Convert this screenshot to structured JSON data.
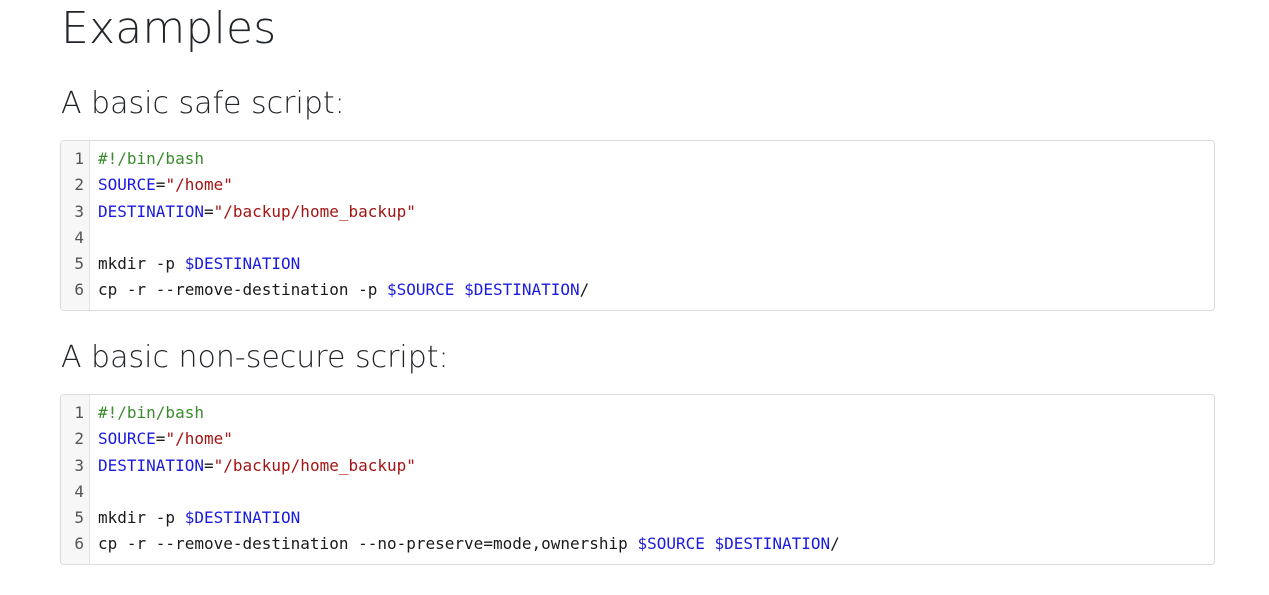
{
  "title": "Examples",
  "sections": [
    {
      "heading": "A basic safe script:",
      "lines": [
        {
          "n": "1",
          "parts": [
            {
              "t": "#!/bin/bash",
              "c": "cm"
            }
          ]
        },
        {
          "n": "2",
          "parts": [
            {
              "t": "SOURCE",
              "c": "var"
            },
            {
              "t": "=",
              "c": "plain"
            },
            {
              "t": "\"/home\"",
              "c": "str"
            }
          ]
        },
        {
          "n": "3",
          "parts": [
            {
              "t": "DESTINATION",
              "c": "var"
            },
            {
              "t": "=",
              "c": "plain"
            },
            {
              "t": "\"/backup/home_backup\"",
              "c": "str"
            }
          ]
        },
        {
          "n": "4",
          "parts": []
        },
        {
          "n": "5",
          "parts": [
            {
              "t": "mkdir -p ",
              "c": "plain"
            },
            {
              "t": "$DESTINATION",
              "c": "var"
            }
          ]
        },
        {
          "n": "6",
          "parts": [
            {
              "t": "cp -r --remove-destination -p ",
              "c": "plain"
            },
            {
              "t": "$SOURCE",
              "c": "var"
            },
            {
              "t": " ",
              "c": "plain"
            },
            {
              "t": "$DESTINATION",
              "c": "var"
            },
            {
              "t": "/",
              "c": "plain"
            }
          ]
        }
      ]
    },
    {
      "heading": "A basic non-secure script:",
      "lines": [
        {
          "n": "1",
          "parts": [
            {
              "t": "#!/bin/bash",
              "c": "cm"
            }
          ]
        },
        {
          "n": "2",
          "parts": [
            {
              "t": "SOURCE",
              "c": "var"
            },
            {
              "t": "=",
              "c": "plain"
            },
            {
              "t": "\"/home\"",
              "c": "str"
            }
          ]
        },
        {
          "n": "3",
          "parts": [
            {
              "t": "DESTINATION",
              "c": "var"
            },
            {
              "t": "=",
              "c": "plain"
            },
            {
              "t": "\"/backup/home_backup\"",
              "c": "str"
            }
          ]
        },
        {
          "n": "4",
          "parts": []
        },
        {
          "n": "5",
          "parts": [
            {
              "t": "mkdir -p ",
              "c": "plain"
            },
            {
              "t": "$DESTINATION",
              "c": "var"
            }
          ]
        },
        {
          "n": "6",
          "parts": [
            {
              "t": "cp -r --remove-destination --no-preserve=mode,ownership ",
              "c": "plain"
            },
            {
              "t": "$SOURCE",
              "c": "var"
            },
            {
              "t": " ",
              "c": "plain"
            },
            {
              "t": "$DESTINATION",
              "c": "var"
            },
            {
              "t": "/",
              "c": "plain"
            }
          ]
        }
      ]
    }
  ],
  "colors": {
    "comment": "#3a8a2e",
    "variable": "#1a1ae0",
    "string": "#a31515",
    "text": "#1a1a1a"
  }
}
